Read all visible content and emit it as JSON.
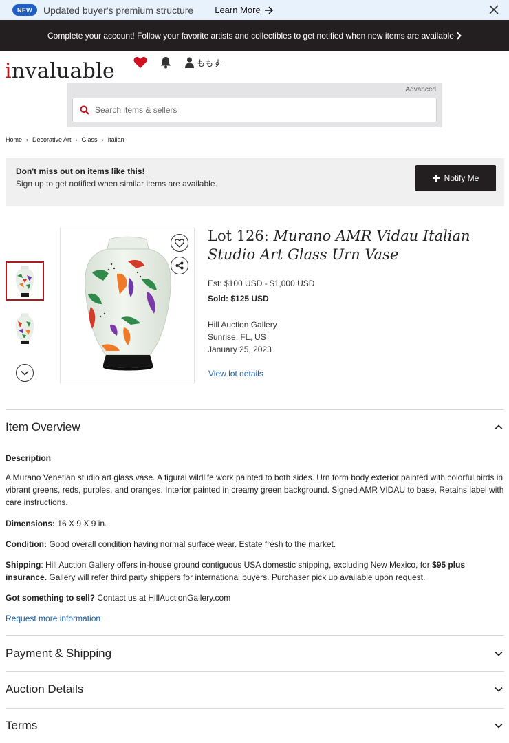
{
  "topbar": {
    "badge": "NEW",
    "message": "Updated buyer's premium structure",
    "learn_more": "Learn More"
  },
  "banner": {
    "text": "Complete your account! Follow your favorite artists and collectibles to get notified when new items are available"
  },
  "header": {
    "logo_first": "i",
    "logo_rest": "nvaluable",
    "user_name": "ももす",
    "advanced": "Advanced",
    "search_placeholder": "Search items & sellers"
  },
  "breadcrumb": [
    "Home",
    "Decorative Art",
    "Glass",
    "Italian"
  ],
  "notify": {
    "title": "Don't miss out on items like this!",
    "subtitle": "Sign up to get notified when similar items are available.",
    "button": "Notify Me"
  },
  "lot": {
    "prefix": "Lot 126: ",
    "title": "Murano AMR Vidau Italian Studio Art Glass Urn Vase",
    "estimate": "Est: $100 USD - $1,000 USD",
    "sold_label": "Sold:",
    "sold_value": "$125 USD",
    "house": "Hill Auction Gallery",
    "location": "Sunrise, FL, US",
    "date": "January 25, 2023",
    "view_details": "View lot details"
  },
  "overview": {
    "heading": "Item Overview",
    "desc_label": "Description",
    "description": "A Murano Venetian studio art glass vase. A figural wildlife work painted to both sides. Urn form body exterior painted with colorful birds in vibrant greens, reds, purples, and oranges. Interior painted in creamy green background. Signed AMR VIDAU to base. Retains label with care instructions.",
    "dimensions_label": "Dimensions:",
    "dimensions": "16 X 9 X 9 in.",
    "condition_label": "Condition:",
    "condition": "Good overall condition having normal surface wear. Estate fresh to the market.",
    "shipping_label": "Shipping",
    "shipping_a": ": Hill Auction Gallery offers in-house ground contiguous USA domestic shipping, excluding New Mexico, for ",
    "shipping_bold": "$95 plus insurance.",
    "shipping_b": " Gallery will refer third party shippers for international buyers. Purchaser pick up available upon request.",
    "sell_label": "Got something to sell?",
    "sell": " Contact us at HillAuctionGallery.com",
    "request": "Request more information"
  },
  "sections": [
    "Payment & Shipping",
    "Auction Details",
    "Terms"
  ],
  "colors": {
    "brand_red": "#c0141c",
    "link_blue": "#1a5fa8",
    "dark": "#231f20",
    "badge_blue": "#1f5fc4"
  }
}
